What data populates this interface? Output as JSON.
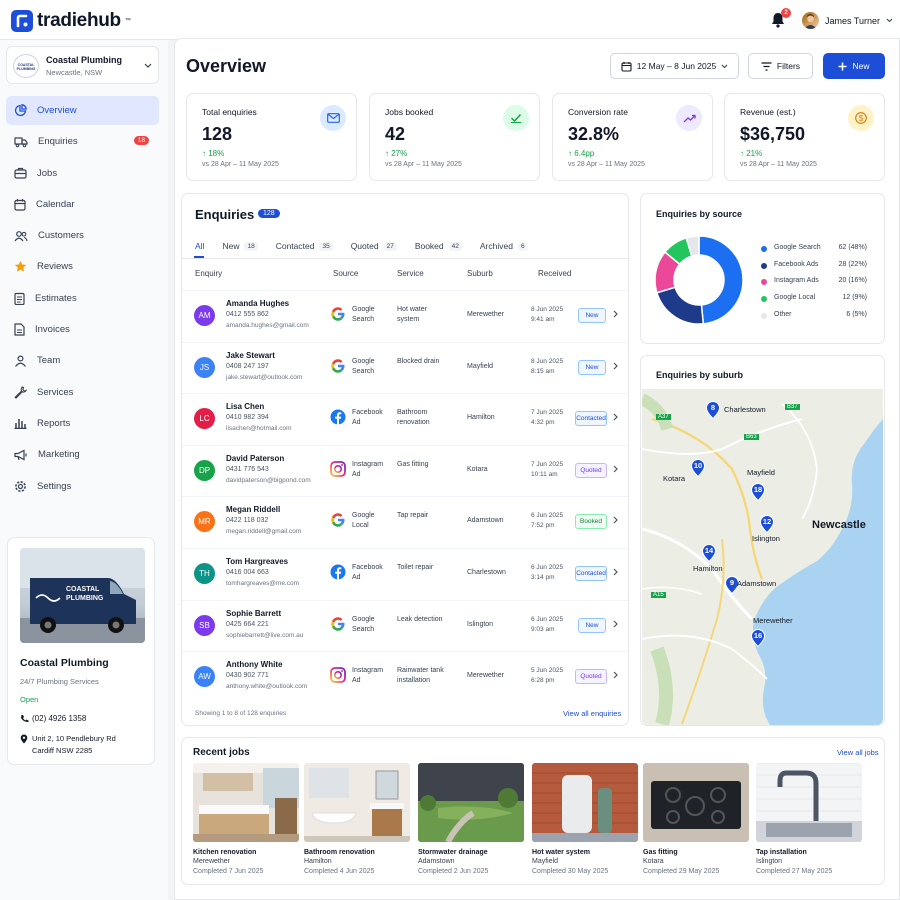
{
  "app": {
    "name": "tradiehub",
    "tm": "™",
    "notifications": "2",
    "user_name": "James Turner"
  },
  "business": {
    "name": "Coastal Plumbing",
    "location": "Newcastle, NSW",
    "logo_text": "COASTAL PLUMBING"
  },
  "nav": [
    {
      "label": "Overview",
      "active": true
    },
    {
      "label": "Enquiries",
      "badge": "18"
    },
    {
      "label": "Jobs"
    },
    {
      "label": "Calendar"
    },
    {
      "label": "Customers"
    },
    {
      "label": "Reviews"
    },
    {
      "label": "Estimates"
    },
    {
      "label": "Invoices"
    },
    {
      "label": "Team"
    },
    {
      "label": "Services"
    },
    {
      "label": "Reports"
    },
    {
      "label": "Marketing"
    },
    {
      "label": "Settings"
    }
  ],
  "biz_card": {
    "van_text_1": "COASTAL",
    "van_text_2": "PLUMBING",
    "name": "Coastal Plumbing",
    "tagline": "24/7 Plumbing Services",
    "status": "Open",
    "phone": "(02) 4926 1358",
    "address_1": "Unit 2, 10 Pendlebury Rd",
    "address_2": "Cardiff NSW 2285"
  },
  "header": {
    "title": "Overview",
    "date_range": "12 May – 8 Jun 2025",
    "filters": "Filters",
    "new": "New"
  },
  "kpis": [
    {
      "label": "Total enquiries",
      "value": "128",
      "delta": "18%",
      "period": "vs 28 Apr – 11 May 2025",
      "icon": "mail-icon",
      "color": "#dbeafe",
      "fg": "#2563eb"
    },
    {
      "label": "Jobs booked",
      "value": "42",
      "delta": "27%",
      "period": "vs 28 Apr – 11 May 2025",
      "icon": "check-icon",
      "color": "#dcfce7",
      "fg": "#16a34a"
    },
    {
      "label": "Conversion rate",
      "value": "32.8%",
      "delta": "6.4pp",
      "period": "vs 28 Apr – 11 May 2025",
      "icon": "trend-icon",
      "color": "#ede9fe",
      "fg": "#7c3aed"
    },
    {
      "label": "Revenue (est.)",
      "value": "$36,750",
      "delta": "21%",
      "period": "vs 28 Apr – 11 May 2025",
      "icon": "dollar-icon",
      "color": "#fef3c7",
      "fg": "#d97706"
    }
  ],
  "enquiries": {
    "title": "Enquiries",
    "count": "128",
    "tabs": [
      {
        "label": "All",
        "count": ""
      },
      {
        "label": "New",
        "count": "18"
      },
      {
        "label": "Contacted",
        "count": "35"
      },
      {
        "label": "Quoted",
        "count": "27"
      },
      {
        "label": "Booked",
        "count": "42"
      },
      {
        "label": "Archived",
        "count": "6"
      }
    ],
    "columns": [
      "Enquiry",
      "Source",
      "Service",
      "Suburb",
      "Received"
    ],
    "rows": [
      {
        "initials": "AM",
        "color": "#7c3aed",
        "name": "Amanda Hughes",
        "phone": "0412 555 862",
        "email": "amanda.hughes@gmail.com",
        "src_icon": "google",
        "src1": "Google",
        "src2": "Search",
        "svc1": "Hot water",
        "svc2": "system",
        "suburb": "Merewether",
        "date": "8 Jun 2025",
        "time": "9:41 am",
        "status": "New"
      },
      {
        "initials": "JS",
        "color": "#3b82f6",
        "name": "Jake Stewart",
        "phone": "0408 247 197",
        "email": "jake.stewart@outlook.com",
        "src_icon": "google",
        "src1": "Google",
        "src2": "Search",
        "svc1": "Blocked drain",
        "svc2": "",
        "suburb": "Mayfield",
        "date": "8 Jun 2025",
        "time": "8:15 am",
        "status": "New"
      },
      {
        "initials": "LC",
        "color": "#e11d48",
        "name": "Lisa Chen",
        "phone": "0410 982 394",
        "email": "lisachen@hotmail.com",
        "src_icon": "facebook",
        "src1": "Facebook",
        "src2": "Ad",
        "svc1": "Bathroom",
        "svc2": "renovation",
        "suburb": "Hamilton",
        "date": "7 Jun 2025",
        "time": "4:32 pm",
        "status": "Contacted"
      },
      {
        "initials": "DP",
        "color": "#16a34a",
        "name": "David Paterson",
        "phone": "0431 776 543",
        "email": "davidpaterson@bigpond.com",
        "src_icon": "instagram",
        "src1": "Instagram",
        "src2": "Ad",
        "svc1": "Gas fitting",
        "svc2": "",
        "suburb": "Kotara",
        "date": "7 Jun 2025",
        "time": "10:11 am",
        "status": "Quoted"
      },
      {
        "initials": "MR",
        "color": "#f97316",
        "name": "Megan Riddell",
        "phone": "0422 118 032",
        "email": "megan.riddell@gmail.com",
        "src_icon": "google",
        "src1": "Google",
        "src2": "Local",
        "svc1": "Tap repair",
        "svc2": "",
        "suburb": "Adamstown",
        "date": "6 Jun 2025",
        "time": "7:52 pm",
        "status": "Booked"
      },
      {
        "initials": "TH",
        "color": "#0d9488",
        "name": "Tom Hargreaves",
        "phone": "0416 004 663",
        "email": "tomhargreaves@me.com",
        "src_icon": "facebook",
        "src1": "Facebook",
        "src2": "Ad",
        "svc1": "Toilet repair",
        "svc2": "",
        "suburb": "Charlestown",
        "date": "6 Jun 2025",
        "time": "3:14 pm",
        "status": "Contacted"
      },
      {
        "initials": "SB",
        "color": "#7c3aed",
        "name": "Sophie Barrett",
        "phone": "0425 664 221",
        "email": "sophiebarrett@live.com.au",
        "src_icon": "google",
        "src1": "Google",
        "src2": "Search",
        "svc1": "Leak detection",
        "svc2": "",
        "suburb": "Islington",
        "date": "6 Jun 2025",
        "time": "9:03 am",
        "status": "New"
      },
      {
        "initials": "AW",
        "color": "#3b82f6",
        "name": "Anthony White",
        "phone": "0430 902 771",
        "email": "anthony.white@outlook.com",
        "src_icon": "instagram",
        "src1": "Instagram",
        "src2": "Ad",
        "svc1": "Rainwater tank",
        "svc2": "installation",
        "suburb": "Merewether",
        "date": "5 Jun 2025",
        "time": "6:28 pm",
        "status": "Quoted"
      }
    ],
    "footer": "Showing 1 to 8 of 128 enquiries",
    "view_all": "View all enquiries"
  },
  "chart_data": {
    "type": "pie",
    "title": "Enquiries by source",
    "categories": [
      "Google Search",
      "Facebook Ads",
      "Instagram Ads",
      "Google Local",
      "Other"
    ],
    "values": [
      62,
      28,
      20,
      12,
      6
    ],
    "labels": [
      "62 (48%)",
      "28 (22%)",
      "20 (16%)",
      "12 (9%)",
      "6 (5%)"
    ],
    "colors": [
      "#1d6ff2",
      "#1e3a8a",
      "#ec4899",
      "#22c55e",
      "#e5e7eb"
    ],
    "legend": "right"
  },
  "suburb_map": {
    "title": "Enquiries by suburb",
    "pins": [
      {
        "n": "8",
        "place": "Charlestown"
      },
      {
        "n": "10",
        "place": "Kotara"
      },
      {
        "n": "18",
        "place": "Mayfield"
      },
      {
        "n": "12",
        "place": "Islington"
      },
      {
        "n": "14",
        "place": "Hamilton"
      },
      {
        "n": "9",
        "place": "Adamstown"
      },
      {
        "n": "16",
        "place": "Merewether"
      }
    ],
    "city": "Newcastle",
    "roads": [
      "A37",
      "B37",
      "B63",
      "A15"
    ]
  },
  "recent_jobs": {
    "title": "Recent jobs",
    "view_all": "View all jobs",
    "items": [
      {
        "title": "Kitchen renovation",
        "suburb": "Merewether",
        "date": "Completed 7 Jun 2025"
      },
      {
        "title": "Bathroom renovation",
        "suburb": "Hamilton",
        "date": "Completed 4 Jun 2025"
      },
      {
        "title": "Stormwater drainage",
        "suburb": "Adamstown",
        "date": "Completed 2 Jun 2025"
      },
      {
        "title": "Hot water system",
        "suburb": "Mayfield",
        "date": "Completed 30 May 2025"
      },
      {
        "title": "Gas fitting",
        "suburb": "Kotara",
        "date": "Completed 29 May 2025"
      },
      {
        "title": "Tap installation",
        "suburb": "Islington",
        "date": "Completed 27 May 2025"
      }
    ]
  }
}
